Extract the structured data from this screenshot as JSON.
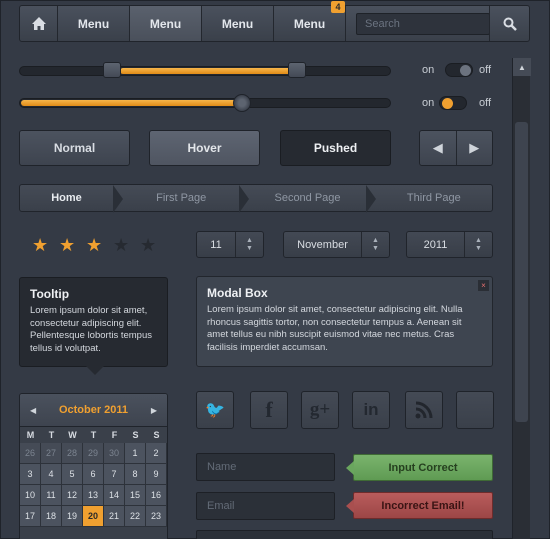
{
  "nav": {
    "home_icon": "home-icon",
    "items": [
      {
        "label": "Menu"
      },
      {
        "label": "Menu"
      },
      {
        "label": "Menu"
      },
      {
        "label": "Menu",
        "badge": "4"
      }
    ],
    "search_placeholder": "Search",
    "search_icon": "magnifier-icon"
  },
  "sliders": [
    {
      "value_range": [
        0.3,
        0.73
      ],
      "toggle_on": "on",
      "toggle_off": "off"
    },
    {
      "value": 0.6,
      "toggle_on": "on",
      "toggle_off": "off"
    }
  ],
  "buttons": {
    "normal": "Normal",
    "hover": "Hover",
    "pushed": "Pushed"
  },
  "breadcrumb": [
    "Home",
    "First Page",
    "Second Page",
    "Third Page"
  ],
  "rating": {
    "value": 3,
    "max": 5,
    "active_color": "#f0a030"
  },
  "spinners": {
    "day": "11",
    "month": "November",
    "year": "2011"
  },
  "tooltip": {
    "title": "Tooltip",
    "text": "Lorem ipsum dolor sit amet, consectetur adipiscing elit. Pellentesque lobortis tempus tellus id volutpat."
  },
  "modal": {
    "title": "Modal Box",
    "text": "Lorem ipsum dolor sit amet, consectetur adipiscing elit. Nulla rhoncus sagittis tortor, non consectetur tempus a. Aenean sit amet tellus eu nibh suscipit euismod vitae nec metus. Cras facilisis imperdiet accumsan.",
    "close": "×"
  },
  "calendar": {
    "title": "October 2011",
    "days_of_week": [
      "M",
      "T",
      "W",
      "T",
      "F",
      "S",
      "S"
    ],
    "weeks": [
      [
        {
          "d": "26",
          "m": true
        },
        {
          "d": "27",
          "m": true
        },
        {
          "d": "28",
          "m": true
        },
        {
          "d": "29",
          "m": true
        },
        {
          "d": "30",
          "m": true
        },
        {
          "d": "1"
        },
        {
          "d": "2"
        }
      ],
      [
        {
          "d": "3"
        },
        {
          "d": "4"
        },
        {
          "d": "5"
        },
        {
          "d": "6"
        },
        {
          "d": "7"
        },
        {
          "d": "8"
        },
        {
          "d": "9"
        }
      ],
      [
        {
          "d": "10"
        },
        {
          "d": "11"
        },
        {
          "d": "12"
        },
        {
          "d": "13"
        },
        {
          "d": "14"
        },
        {
          "d": "15"
        },
        {
          "d": "16"
        }
      ],
      [
        {
          "d": "17"
        },
        {
          "d": "18"
        },
        {
          "d": "19"
        },
        {
          "d": "20",
          "today": true
        },
        {
          "d": "21"
        },
        {
          "d": "22"
        },
        {
          "d": "23"
        }
      ]
    ]
  },
  "social": [
    "twitter-icon",
    "facebook-icon",
    "google-plus-icon",
    "linkedin-icon",
    "rss-icon",
    "blank-icon"
  ],
  "social_glyphs": [
    "🐦",
    "f",
    "g+",
    "in",
    "◉",
    ""
  ],
  "form": {
    "name_placeholder": "Name",
    "email_placeholder": "Email",
    "ok_message": "Input Correct",
    "error_message": "Incorrect Email!"
  }
}
